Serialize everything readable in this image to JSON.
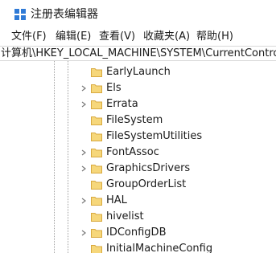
{
  "window": {
    "title": "注册表编辑器",
    "icon": "registry-editor-icon"
  },
  "menu": {
    "items": [
      {
        "label": "文件(F)"
      },
      {
        "label": "编辑(E)"
      },
      {
        "label": "查看(V)"
      },
      {
        "label": "收藏夹(A)"
      },
      {
        "label": "帮助(H)"
      }
    ]
  },
  "address": {
    "path": "计算机\\HKEY_LOCAL_MACHINE\\SYSTEM\\CurrentControlSet"
  },
  "tree": {
    "items": [
      {
        "label": "EarlyLaunch",
        "expandable": false
      },
      {
        "label": "Els",
        "expandable": true
      },
      {
        "label": "Errata",
        "expandable": true
      },
      {
        "label": "FileSystem",
        "expandable": false
      },
      {
        "label": "FileSystemUtilities",
        "expandable": false
      },
      {
        "label": "FontAssoc",
        "expandable": true
      },
      {
        "label": "GraphicsDrivers",
        "expandable": true
      },
      {
        "label": "GroupOrderList",
        "expandable": false
      },
      {
        "label": "HAL",
        "expandable": true
      },
      {
        "label": "hivelist",
        "expandable": false
      },
      {
        "label": "IDConfigDB",
        "expandable": true
      },
      {
        "label": "InitialMachineConfig",
        "expandable": false
      }
    ]
  },
  "colors": {
    "folder_fill": "#f6d77b",
    "folder_stroke": "#d8a93f",
    "chevron": "#7a7a7a",
    "tree_guide": "#a0a0a0"
  }
}
